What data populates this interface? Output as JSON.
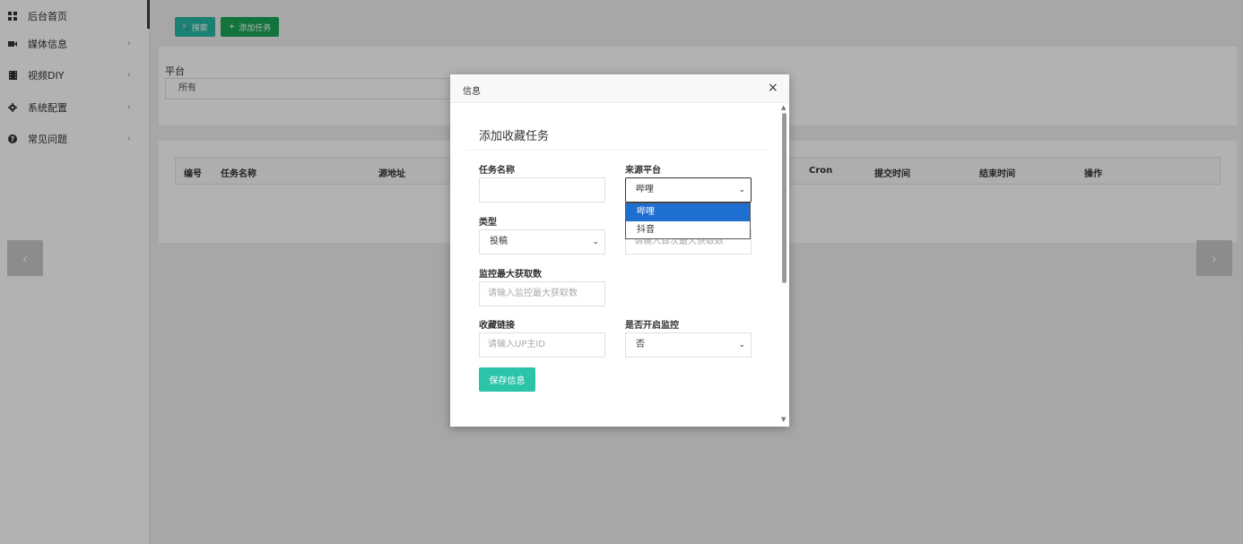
{
  "sidebar": {
    "items": [
      {
        "label": "后台首页",
        "icon": "dashboard-icon"
      },
      {
        "label": "媒体信息",
        "icon": "video-camera-icon",
        "chevron": "›"
      },
      {
        "label": "视频DIY",
        "icon": "film-icon",
        "chevron": "›"
      },
      {
        "label": "系统配置",
        "icon": "gear-icon",
        "chevron": "›"
      },
      {
        "label": "常见问题",
        "icon": "question-circle-icon",
        "chevron": "›"
      }
    ]
  },
  "toolbar": {
    "search_label": "搜索",
    "search_icon": "🔍",
    "add_label": "添加任务",
    "add_icon": "+"
  },
  "filter": {
    "platform_label": "平台",
    "platform_value": "所有"
  },
  "table": {
    "columns": [
      "编号",
      "任务名称",
      "源地址",
      "Cron",
      "提交时间",
      "结束时间",
      "操作"
    ]
  },
  "nav": {
    "prev": "‹",
    "next": "›"
  },
  "modal": {
    "title": "信息",
    "close": "×",
    "heading": "添加收藏任务",
    "fields": {
      "task_name_label": "任务名称",
      "task_name_value": "",
      "source_platform_label": "来源平台",
      "source_platform_value": "哔哩",
      "source_platform_options": [
        "哔哩",
        "抖音"
      ],
      "type_label": "类型",
      "type_value": "投稿",
      "first_fetch_placeholder": "请输入首次最大获取数",
      "monitor_max_label": "监控最大获取数",
      "monitor_max_placeholder": "请输入监控最大获取数",
      "favorite_link_label": "收藏链接",
      "favorite_link_placeholder": "请输入UP主ID",
      "enable_monitor_label": "是否开启监控",
      "enable_monitor_value": "否"
    },
    "save_label": "保存信息"
  },
  "colors": {
    "search_button": "#26b8a3",
    "add_button": "#1aa557",
    "save_button": "#2bc4a9",
    "dropdown_selected": "#1f6fd0"
  }
}
